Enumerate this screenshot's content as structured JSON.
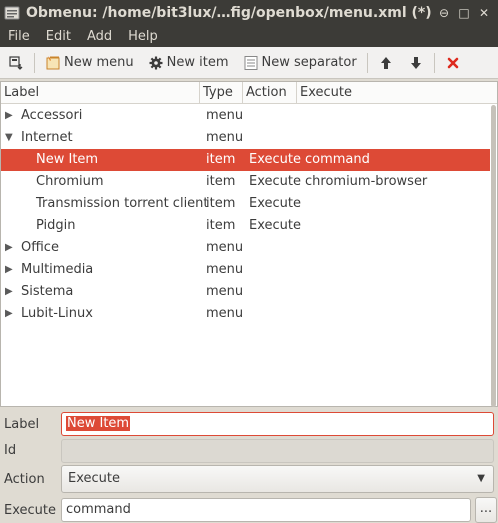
{
  "window": {
    "title": "Obmenu: /home/bit3lux/…fig/openbox/menu.xml (*)",
    "icon": "obmenu-app-icon",
    "controls": {
      "minimize": "⊖",
      "maximize": "□",
      "close": "✕"
    }
  },
  "menubar": [
    "File",
    "Edit",
    "Add",
    "Help"
  ],
  "toolbar": {
    "new_menu": "New menu",
    "new_item": "New item",
    "new_separator": "New separator"
  },
  "tree": {
    "columns": [
      "Label",
      "Type",
      "Action",
      "Execute"
    ],
    "rows": [
      {
        "expander": "▶",
        "label": "Accessori",
        "type": "menu",
        "action": "",
        "execute": "",
        "selected": false,
        "level": 0
      },
      {
        "expander": "▼",
        "label": "Internet",
        "type": "menu",
        "action": "",
        "execute": "",
        "selected": false,
        "level": 0
      },
      {
        "expander": "",
        "label": "New Item",
        "type": "item",
        "action": "Execute",
        "execute": "command",
        "selected": true,
        "level": 1
      },
      {
        "expander": "",
        "label": "Chromium",
        "type": "item",
        "action": "Execute",
        "execute": "chromium-browser",
        "selected": false,
        "level": 1
      },
      {
        "expander": "",
        "label": "Transmission torrent client",
        "type": "item",
        "action": "Execute",
        "execute": "",
        "selected": false,
        "level": 1
      },
      {
        "expander": "",
        "label": "Pidgin",
        "type": "item",
        "action": "Execute",
        "execute": "",
        "selected": false,
        "level": 1
      },
      {
        "expander": "▶",
        "label": "Office",
        "type": "menu",
        "action": "",
        "execute": "",
        "selected": false,
        "level": 0
      },
      {
        "expander": "▶",
        "label": "Multimedia",
        "type": "menu",
        "action": "",
        "execute": "",
        "selected": false,
        "level": 0
      },
      {
        "expander": "▶",
        "label": "Sistema",
        "type": "menu",
        "action": "",
        "execute": "",
        "selected": false,
        "level": 0
      },
      {
        "expander": "▶",
        "label": "Lubit-Linux",
        "type": "menu",
        "action": "",
        "execute": "",
        "selected": false,
        "level": 0
      }
    ]
  },
  "form": {
    "label_caption": "Label",
    "label_value": "New Item",
    "id_caption": "Id",
    "id_value": "",
    "action_caption": "Action",
    "action_value": "Execute",
    "execute_caption": "Execute",
    "execute_value": "command",
    "browse_label": "..."
  },
  "colors": {
    "accent": "#dd4a36",
    "titlebar": "#3c3b37",
    "window_bg": "#dfdbd2"
  }
}
